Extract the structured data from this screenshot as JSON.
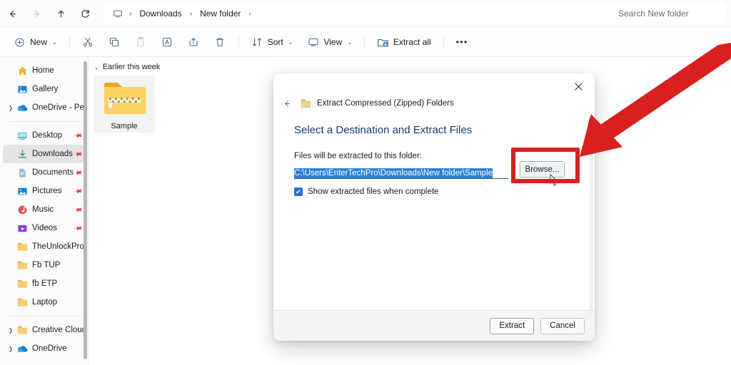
{
  "window": {
    "nav": {
      "back_icon": "arrow-left-icon",
      "forward_icon": "arrow-right-icon",
      "up_icon": "arrow-up-icon",
      "refresh_icon": "refresh-icon",
      "monitor_icon": "this-pc-icon",
      "breadcrumbs": [
        "Downloads",
        "New folder"
      ],
      "separator": "›"
    },
    "search": {
      "placeholder": "Search New folder",
      "value": ""
    }
  },
  "toolbar": {
    "new_label": "New",
    "new_icon": "plus-circle-icon",
    "cut_icon": "scissors-icon",
    "copy_icon": "copy-icon",
    "paste_icon": "paste-icon",
    "rename_icon": "rename-icon",
    "share_icon": "share-icon",
    "delete_icon": "trash-icon",
    "sort_label": "Sort",
    "sort_icon": "sort-icon",
    "view_label": "View",
    "view_icon": "view-icon",
    "extract_all_label": "Extract all",
    "extract_all_icon": "extract-folder-icon",
    "overflow_label": "•••",
    "caret": "⌄"
  },
  "sidebar": {
    "items": [
      {
        "label": "Home",
        "icon": "home-icon",
        "chevron": false,
        "pinned": false,
        "selected": false,
        "type": "item"
      },
      {
        "label": "Gallery",
        "icon": "gallery-icon",
        "chevron": false,
        "pinned": false,
        "selected": false,
        "type": "item"
      },
      {
        "label": "OneDrive - Perso",
        "icon": "onedrive-icon",
        "chevron": true,
        "pinned": false,
        "selected": false,
        "type": "item"
      },
      {
        "type": "divider"
      },
      {
        "label": "Desktop",
        "icon": "desktop-icon",
        "chevron": false,
        "pinned": true,
        "selected": false,
        "type": "item"
      },
      {
        "label": "Downloads",
        "icon": "download-icon",
        "chevron": false,
        "pinned": true,
        "selected": true,
        "type": "item"
      },
      {
        "label": "Documents",
        "icon": "documents-icon",
        "chevron": false,
        "pinned": true,
        "selected": false,
        "type": "item"
      },
      {
        "label": "Pictures",
        "icon": "pictures-icon",
        "chevron": false,
        "pinned": true,
        "selected": false,
        "type": "item"
      },
      {
        "label": "Music",
        "icon": "music-icon",
        "chevron": false,
        "pinned": true,
        "selected": false,
        "type": "item"
      },
      {
        "label": "Videos",
        "icon": "videos-icon",
        "chevron": false,
        "pinned": true,
        "selected": false,
        "type": "item"
      },
      {
        "label": "TheUnlockPro",
        "icon": "folder-icon",
        "chevron": false,
        "pinned": false,
        "selected": false,
        "type": "item"
      },
      {
        "label": "Fb TUP",
        "icon": "folder-icon",
        "chevron": false,
        "pinned": false,
        "selected": false,
        "type": "item"
      },
      {
        "label": "fb ETP",
        "icon": "folder-icon",
        "chevron": false,
        "pinned": false,
        "selected": false,
        "type": "item"
      },
      {
        "label": "Laptop",
        "icon": "folder-icon",
        "chevron": false,
        "pinned": false,
        "selected": false,
        "type": "item"
      },
      {
        "type": "divider"
      },
      {
        "label": "Creative Cloud F",
        "icon": "folder-icon",
        "chevron": true,
        "pinned": false,
        "selected": false,
        "type": "item"
      },
      {
        "label": "OneDrive",
        "icon": "onedrive-icon",
        "chevron": true,
        "pinned": false,
        "selected": false,
        "type": "item"
      }
    ]
  },
  "content": {
    "group_label": "Earlier this week",
    "group_chevron": "⌄",
    "files": [
      {
        "name": "Sample",
        "icon": "zipped-folder-icon"
      }
    ]
  },
  "dialog": {
    "close_icon": "close-icon",
    "back_icon": "arrow-left-icon",
    "title_icon": "zipped-folder-icon",
    "title": "Extract Compressed (Zipped) Folders",
    "heading": "Select a Destination and Extract Files",
    "path_label": "Files will be extracted to this folder:",
    "path_value": "C:\\Users\\EnterTechPro\\Downloads\\New folder\\Sample",
    "browse_label": "Browse...",
    "checkbox": {
      "label": "Show extracted files when complete",
      "checked": true,
      "mark": "✔"
    },
    "extract_label": "Extract",
    "cancel_label": "Cancel",
    "cursor_icon": "mouse-pointer-icon"
  },
  "annotations": {
    "highlight_color": "#da1f1f",
    "arrow_color": "#da1f1f",
    "arrow_icon": "red-arrow-icon",
    "highlight_target": "browse-button"
  },
  "colors": {
    "accent": "#2f7fd4",
    "heading": "#113d6e",
    "selection": "#2f7fd4",
    "annotation_red": "#da1f1f",
    "toolbar_icon": "#4a6d8c"
  }
}
